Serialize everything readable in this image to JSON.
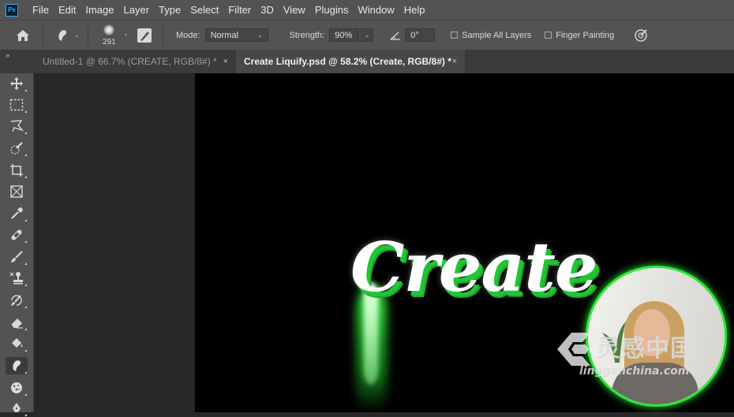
{
  "app": {
    "logo_text": "Ps"
  },
  "menu": [
    "File",
    "Edit",
    "Image",
    "Layer",
    "Type",
    "Select",
    "Filter",
    "3D",
    "View",
    "Plugins",
    "Window",
    "Help"
  ],
  "options": {
    "brush_size": "291",
    "mode_label": "Mode:",
    "mode_value": "Normal",
    "strength_label": "Strength:",
    "strength_value": "90%",
    "angle_value": "0°",
    "sample_all_layers": "Sample All Layers",
    "finger_painting": "Finger Painting"
  },
  "tabs": [
    {
      "label": "Untitled-1 @ 66.7% (CREATE, RGB/8#) *",
      "close": "×"
    },
    {
      "label": "Create Liquify.psd @ 58.2% (Create, RGB/8#) *",
      "close": "×"
    }
  ],
  "panel_collapse": "»",
  "tools": [
    "move-tool",
    "marquee-tool",
    "lasso-tool",
    "quick-selection-tool",
    "crop-tool",
    "frame-tool",
    "eyedropper-tool",
    "healing-brush-tool",
    "brush-tool",
    "clone-stamp-tool",
    "history-brush-tool",
    "eraser-tool",
    "paint-bucket-tool",
    "smudge-tool",
    "sponge-tool",
    "pen-tool"
  ],
  "canvas": {
    "artwork_text": "Create",
    "glow_color": "#2ee83a"
  },
  "watermark": {
    "chinese": "灵感中国",
    "domain": "lingganchina.com"
  }
}
